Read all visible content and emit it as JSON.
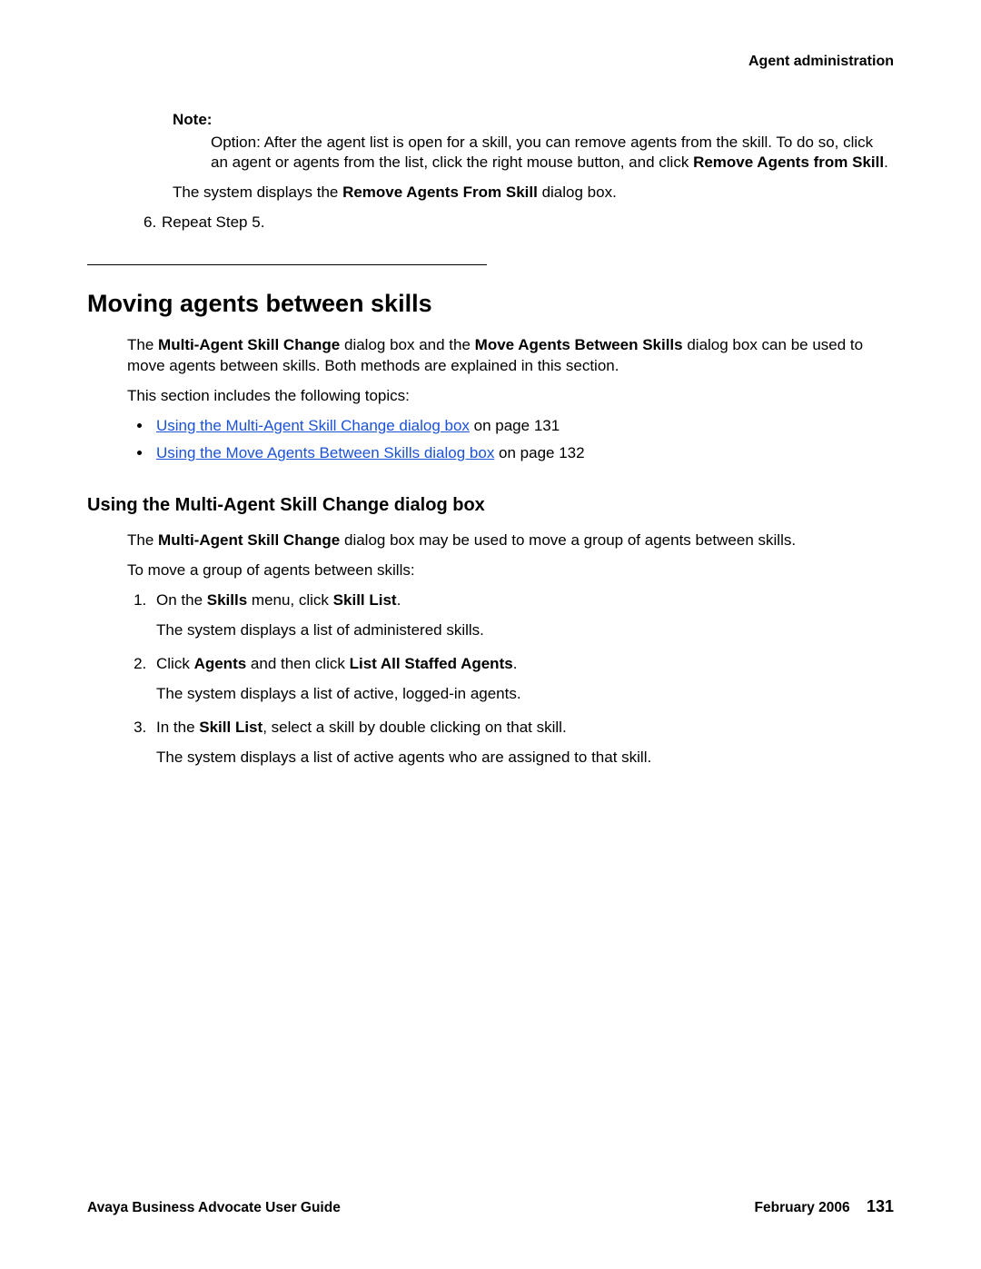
{
  "header": {
    "section": "Agent administration"
  },
  "note": {
    "label": "Note:",
    "body_pre": "Option: After the agent list is open for a skill, you can remove agents from the skill. To do so, click an agent or agents from the list, click the right mouse button, and click ",
    "body_bold": "Remove Agents from Skill",
    "body_post": "."
  },
  "sys_displays": {
    "pre": "The system displays the ",
    "bold": "Remove Agents From Skill",
    "post": " dialog box."
  },
  "step6": {
    "num": "6.",
    "text": "Repeat Step 5."
  },
  "heading": "Moving agents between skills",
  "intro": {
    "t1": "The ",
    "b1": "Multi-Agent Skill Change",
    "t2": " dialog box and the ",
    "b2": "Move Agents Between Skills",
    "t3": " dialog box can be used to move agents between skills. Both methods are explained in this section."
  },
  "topics_lead": "This section includes the following topics:",
  "topics": [
    {
      "link": "Using the Multi-Agent Skill Change dialog box",
      "suffix": " on page 131"
    },
    {
      "link": "Using the Move Agents Between Skills dialog box",
      "suffix": " on page 132"
    }
  ],
  "subheading": "Using the Multi-Agent Skill Change dialog box",
  "sub_intro": {
    "t1": "The ",
    "b1": "Multi-Agent Skill Change",
    "t2": " dialog box may be used to move a group of agents between skills."
  },
  "steps_lead": "To move a group of agents between skills:",
  "steps": [
    {
      "line": {
        "t1": "On the ",
        "b1": "Skills",
        "t2": " menu, click ",
        "b2": "Skill List",
        "t3": "."
      },
      "after": "The system displays a list of administered skills."
    },
    {
      "line": {
        "t1": "Click ",
        "b1": "Agents",
        "t2": " and then click ",
        "b2": "List All Staffed Agents",
        "t3": "."
      },
      "after": "The system displays a list of active, logged-in agents."
    },
    {
      "line": {
        "t1": "In the ",
        "b1": "Skill List",
        "t2": ", select a skill by double clicking on that skill.",
        "b2": "",
        "t3": ""
      },
      "after": "The system displays a list of active agents who are assigned to that skill."
    }
  ],
  "footer": {
    "left": "Avaya Business Advocate User Guide",
    "date": "February 2006",
    "page": "131"
  }
}
